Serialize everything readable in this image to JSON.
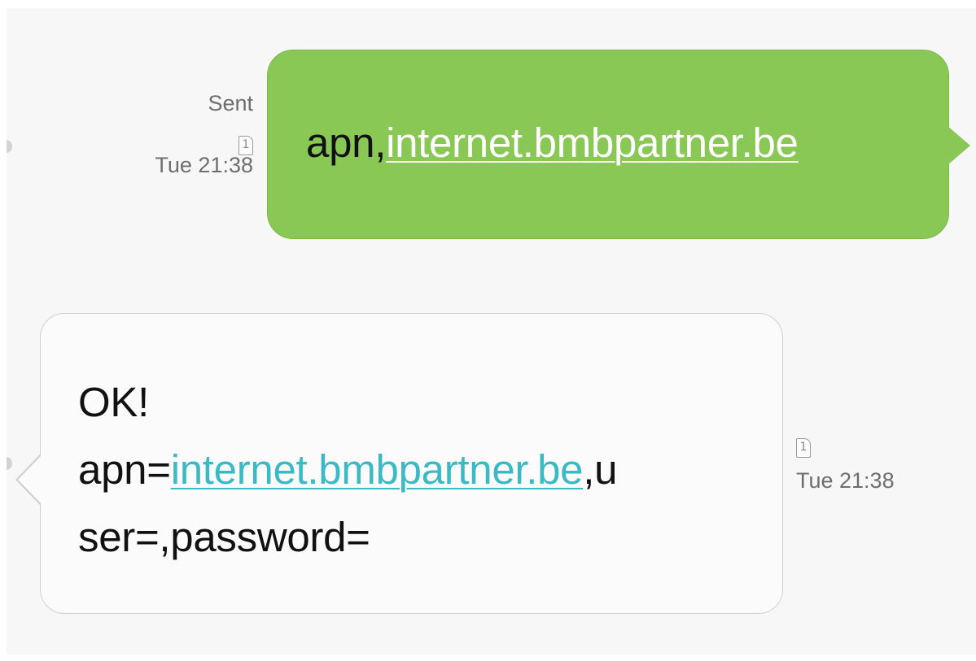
{
  "conversation": {
    "sent": {
      "status": "Sent",
      "sim_slot": "1",
      "time": "Tue 21:38",
      "text_prefix": "apn,",
      "link": "internet.bmbpartner.be",
      "bubble_color": "#8ac855"
    },
    "received": {
      "line1": "OK!",
      "line2_prefix": "apn=",
      "link": "internet.bmbpartner.be",
      "line2_suffix": ",u",
      "line3": "ser=,password=",
      "sim_slot": "1",
      "time": "Tue 21:38",
      "link_color": "#3bb9c4"
    }
  },
  "icons": {
    "sim_icon": "sim-card-icon"
  }
}
